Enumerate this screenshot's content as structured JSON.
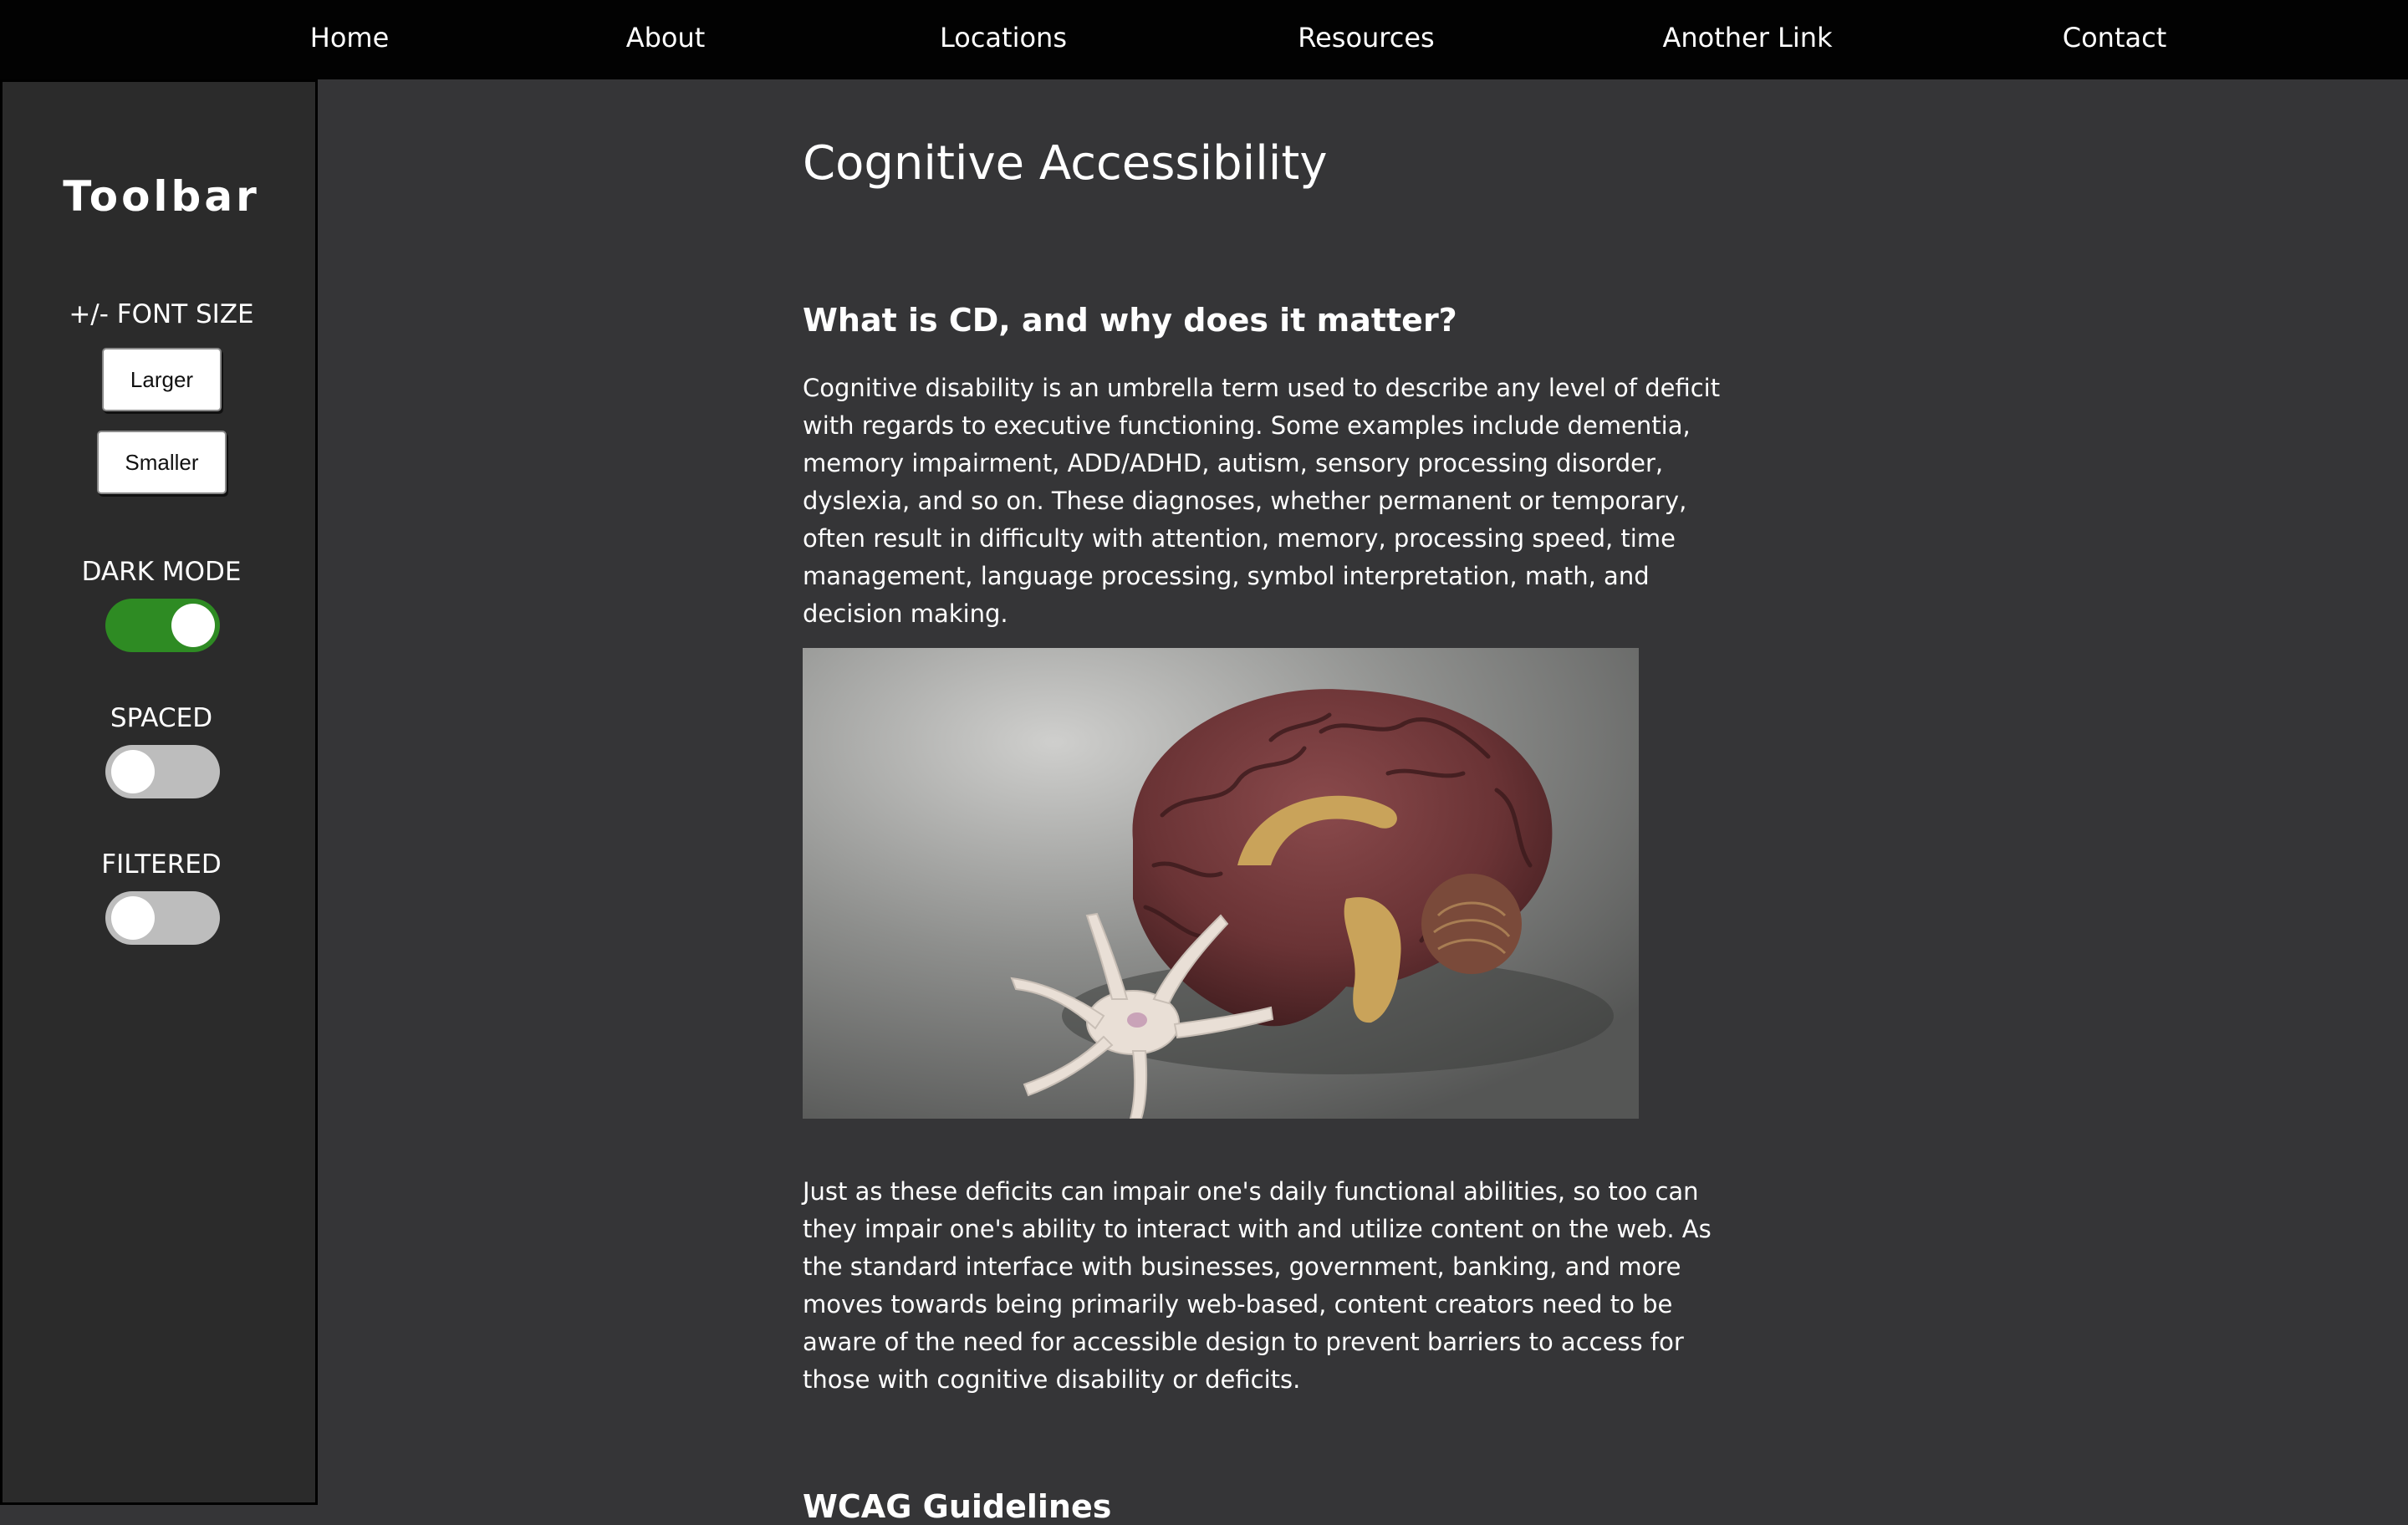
{
  "nav": {
    "links": [
      "Home",
      "About",
      "Locations",
      "Resources",
      "Another Link",
      "Contact"
    ]
  },
  "toolbar": {
    "title": "Toolbar",
    "font_size_label": "+/- FONT SIZE",
    "larger_label": "Larger",
    "smaller_label": "Smaller",
    "dark_mode_label": "DARK MODE",
    "dark_mode_on": true,
    "spaced_label": "SPACED",
    "spaced_on": false,
    "filtered_label": "FILTERED",
    "filtered_on": false
  },
  "main": {
    "title": "Cognitive Accessibility",
    "section1_heading": "What is CD, and why does it matter?",
    "para1": "Cognitive disability is an umbrella term used to describe any level of deficit with regards to executive functioning. Some examples include dementia, memory impairment, ADD/ADHD, autism, sensory processing disorder, dyslexia, and so on. These diagnoses, whether permanent or temporary, often result in difficulty with attention, memory, processing speed, time management, language processing, symbol interpretation, math, and decision making.",
    "para2": "Just as these deficits can impair one's daily functional abilities, so too can they impair one's ability to interact with and utilize content on the web. As the standard interface with businesses, government, banking, and more moves towards being primarily web-based, content creators need to be aware of the need for accessible design to prevent barriers to access for those with cognitive disability or deficits.",
    "section2_heading": "WCAG Guidelines"
  },
  "colors": {
    "nav_bg": "#020202",
    "page_bg": "#353537",
    "sidebar_bg": "#2b2b2b",
    "toggle_on": "#2e8b23",
    "toggle_off": "#bdbdbd"
  }
}
